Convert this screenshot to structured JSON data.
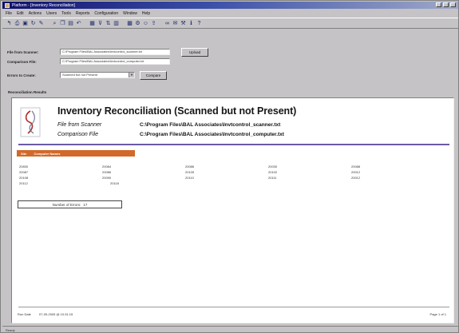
{
  "window": {
    "title": "Platform - [Inventory Reconciliation]"
  },
  "menu": [
    "File",
    "Edit",
    "Actions",
    "Users",
    "Tools",
    "Reports",
    "Configuration",
    "Window",
    "Help"
  ],
  "toolbar": {
    "icons": [
      "arrow-left-icon",
      "print-icon",
      "save-icon",
      "refresh-icon",
      "edit-icon",
      "find-icon",
      "copy-icon",
      "paste-icon",
      "undo-icon",
      "table-icon",
      "filter-icon",
      "sort-icon",
      "chart-icon",
      "grid-icon",
      "settings-icon",
      "user-icon",
      "export-icon",
      "link-icon",
      "mail-icon",
      "tools-icon",
      "info-icon",
      "help-icon"
    ]
  },
  "form": {
    "file_from_scanner_label": "File from Scanner:",
    "file_from_scanner_value": "C:\\Program Files\\BAL Associates\\Invtcontrol_scanner.txt",
    "comparison_file_label": "Comparison File:",
    "comparison_file_value": "C:\\Program Files\\BAL Associates\\Invtcontrol_computer.txt",
    "errors_to_create_label": "Errors to Create:",
    "errors_to_create_value": "Scanned but not Present",
    "upload_button": "Upload",
    "compare_button": "Compare"
  },
  "results": {
    "section_label": "Reconciliation Results",
    "report_title": "Inventory Reconciliation (Scanned but not Present)",
    "file_from_scanner_label": "File from Scanner",
    "file_from_scanner_value": "C:\\Program Files\\BAL Associates\\Invtcontrol_scanner.txt",
    "comparison_file_label": "Comparison File",
    "comparison_file_value": "C:\\Program Files\\BAL Associates\\Invtcontrol_computer.txt",
    "group_header": {
      "col1": "Site",
      "col2": "Computer Names"
    },
    "rows": [
      [
        "20830",
        "20084",
        "20086",
        "20030",
        "20088"
      ],
      [
        "20087",
        "20086",
        "20105",
        "20102",
        "20012"
      ],
      [
        "20108",
        "20090",
        "20110",
        "20111",
        "20012"
      ],
      [
        "20112",
        "20118"
      ]
    ],
    "errors_label": "Number of Errors:",
    "errors_count": "17",
    "footer_left_label": "Run Date",
    "footer_left_value": "07-09-2005 @ 10:31:15",
    "footer_right": "Page 1 of 1"
  },
  "status": {
    "text": "Ready"
  }
}
